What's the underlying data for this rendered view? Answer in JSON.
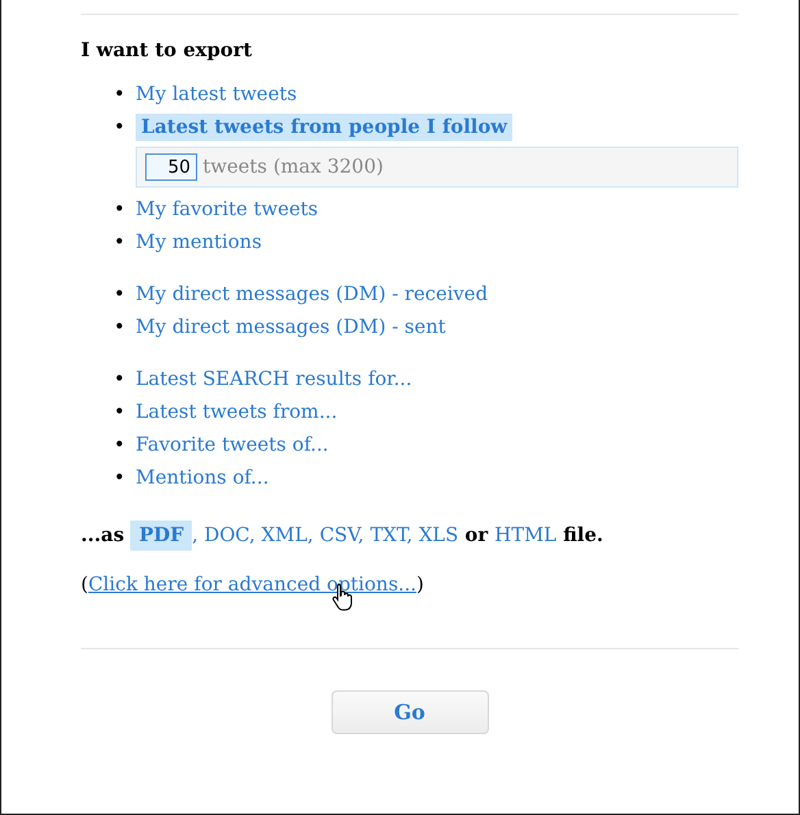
{
  "heading": "I want to export",
  "bullet": "•",
  "groups": [
    {
      "items": [
        {
          "label": "My latest tweets",
          "selected": false
        },
        {
          "label": "Latest tweets from people I follow",
          "selected": true,
          "count": {
            "value": "50",
            "hint": "tweets (max 3200)"
          }
        },
        {
          "label": "My favorite tweets",
          "selected": false
        },
        {
          "label": "My mentions",
          "selected": false
        }
      ]
    },
    {
      "items": [
        {
          "label": "My direct messages (DM) - received",
          "selected": false
        },
        {
          "label": "My direct messages (DM) - sent",
          "selected": false
        }
      ]
    },
    {
      "items": [
        {
          "label": "Latest SEARCH results for...",
          "selected": false
        },
        {
          "label": "Latest tweets from...",
          "selected": false
        },
        {
          "label": "Favorite tweets of...",
          "selected": false
        },
        {
          "label": "Mentions of...",
          "selected": false
        }
      ]
    }
  ],
  "format_line": {
    "prefix": "...as",
    "formats": [
      {
        "label": "PDF",
        "selected": true,
        "after": ","
      },
      {
        "label": "DOC",
        "selected": false,
        "after": ","
      },
      {
        "label": "XML",
        "selected": false,
        "after": ","
      },
      {
        "label": "CSV",
        "selected": false,
        "after": ","
      },
      {
        "label": "TXT",
        "selected": false,
        "after": ","
      },
      {
        "label": "XLS",
        "selected": false,
        "after": " or"
      },
      {
        "label": "HTML",
        "selected": false
      }
    ],
    "suffix": "file."
  },
  "advanced": {
    "open": "(",
    "link": "Click here for advanced options...",
    "close": ")"
  },
  "go_button": "Go"
}
